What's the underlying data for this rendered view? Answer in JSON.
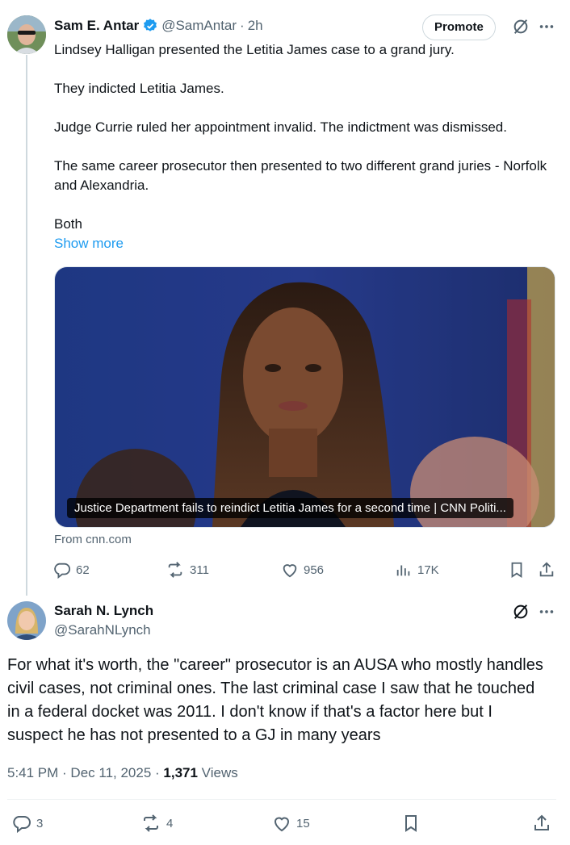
{
  "tweet": {
    "author_name": "Sam E. Antar",
    "handle": "@SamAntar",
    "separator": "·",
    "time": "2h",
    "promote_label": "Promote",
    "paragraphs": [
      "Lindsey Halligan presented the Letitia James case to a grand jury.",
      "They indicted Letitia James.",
      "Judge Currie ruled her appointment invalid. The indictment was dismissed.",
      "The same career prosecutor then presented to two different grand juries - Norfolk and Alexandria.",
      "Both"
    ],
    "show_more": "Show more",
    "card_caption": "Justice Department fails to reindict Letitia James for a second time | CNN Politi...",
    "card_source": "From cnn.com",
    "stats": {
      "replies": "62",
      "reposts": "311",
      "likes": "956",
      "views": "17K"
    }
  },
  "reply": {
    "author_name": "Sarah N. Lynch",
    "handle": "@SarahNLynch",
    "text": "For what it's worth, the \"career\" prosecutor is an AUSA who mostly handles civil cases, not criminal ones. The last criminal case I saw that he touched in a federal docket was 2011. I don't know if that's a factor here but I suspect he has not presented to a GJ in many years",
    "timestamp": "5:41 PM · Dec 11, 2025 · ",
    "views_count": "1,371",
    "views_label": " Views",
    "stats": {
      "replies": "3",
      "reposts": "4",
      "likes": "15"
    }
  },
  "colors": {
    "accent": "#1d9bf0",
    "muted": "#536471",
    "text": "#0f1419",
    "verified": "#1d9bf0"
  },
  "icons": [
    "verified-badge-icon",
    "grok-icon",
    "more-icon",
    "reply-icon",
    "repost-icon",
    "like-icon",
    "views-icon",
    "bookmark-icon",
    "share-icon"
  ]
}
